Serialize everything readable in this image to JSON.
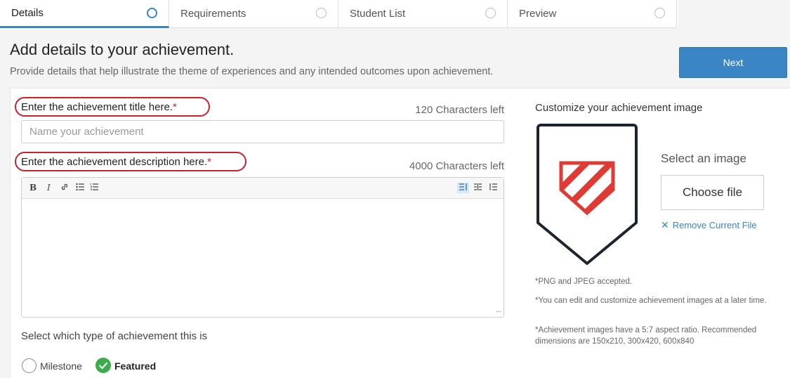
{
  "tabs": [
    {
      "label": "Details",
      "active": true
    },
    {
      "label": "Requirements",
      "active": false
    },
    {
      "label": "Student List",
      "active": false
    },
    {
      "label": "Preview",
      "active": false
    }
  ],
  "header": {
    "title": "Add details to your achievement.",
    "subtitle": "Provide details that help illustrate the theme of experiences and any intended outcomes upon achievement.",
    "next_label": "Next"
  },
  "form": {
    "title_label": "Enter the achievement title here.",
    "title_counter": "120 Characters left",
    "title_placeholder": "Name your achievement",
    "description_label": "Enter the achievement description here.",
    "description_counter": "4000 Characters left",
    "required_mark": "*",
    "toolbar": {
      "bold": "B",
      "italic": "I",
      "link": "🔗",
      "bullets": "☰",
      "numbers": "☰",
      "align_left": "≣",
      "align_center": "≣",
      "align_right": "≣"
    },
    "type_label": "Select which type of achievement this is",
    "type_options": [
      {
        "label": "Milestone",
        "selected": false
      },
      {
        "label": "Featured",
        "selected": true
      }
    ]
  },
  "image": {
    "heading": "Customize your achievement image",
    "select_label": "Select an image",
    "choose_label": "Choose file",
    "remove_label": "Remove Current File",
    "notes": [
      "*PNG and JPEG accepted.",
      "*You can edit and customize achievement images at a later time.",
      "*Achievement images have a 5:7 aspect ratio. Recommended dimensions are 150x210, 300x420, 600x840"
    ]
  },
  "colors": {
    "accent": "#3a85c5",
    "required": "#c9222e",
    "success": "#3cab4a",
    "badge_stripe": "#e03a35"
  }
}
